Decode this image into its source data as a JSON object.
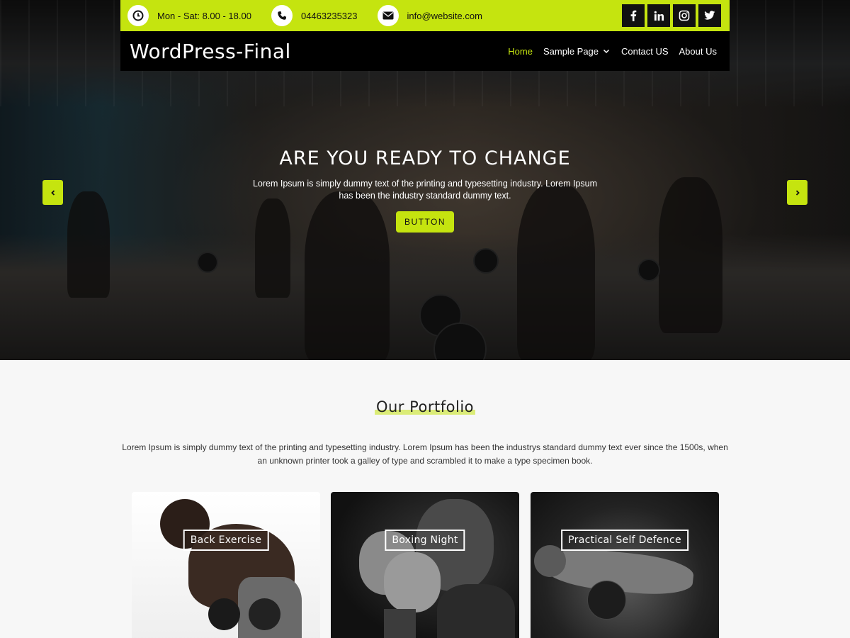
{
  "topbar": {
    "hours": "Mon - Sat: 8.00 - 18.00",
    "phone": "04463235323",
    "email": "info@website.com",
    "accent_color": "#c5e40f",
    "icons": [
      "clock-icon",
      "phone-icon",
      "envelope-icon"
    ],
    "socials": [
      "facebook-icon",
      "linkedin-icon",
      "instagram-icon",
      "twitter-icon"
    ]
  },
  "nav": {
    "logo": "WordPress-Final",
    "items": [
      {
        "label": "Home",
        "active": true
      },
      {
        "label": "Sample Page",
        "has_dropdown": true
      },
      {
        "label": "Contact US"
      },
      {
        "label": "About Us"
      }
    ]
  },
  "hero": {
    "title": "ARE YOU READY TO CHANGE",
    "text": "Lorem Ipsum is simply dummy text of the printing and typesetting industry. Lorem Ipsum has been the industry standard dummy text.",
    "button": "BUTTON",
    "prev_icon": "chevron-left-icon",
    "next_icon": "chevron-right-icon"
  },
  "portfolio": {
    "title": "Our Portfolio",
    "text": "Lorem Ipsum is simply dummy text of the printing and typesetting industry. Lorem Ipsum has been the industrys standard dummy text ever since the 1500s, when an unknown printer took a galley of type and scrambled it to make a type specimen book.",
    "cards": [
      {
        "label": "Back Exercise"
      },
      {
        "label": "Boxing Night"
      },
      {
        "label": "Practical Self Defence"
      }
    ]
  }
}
